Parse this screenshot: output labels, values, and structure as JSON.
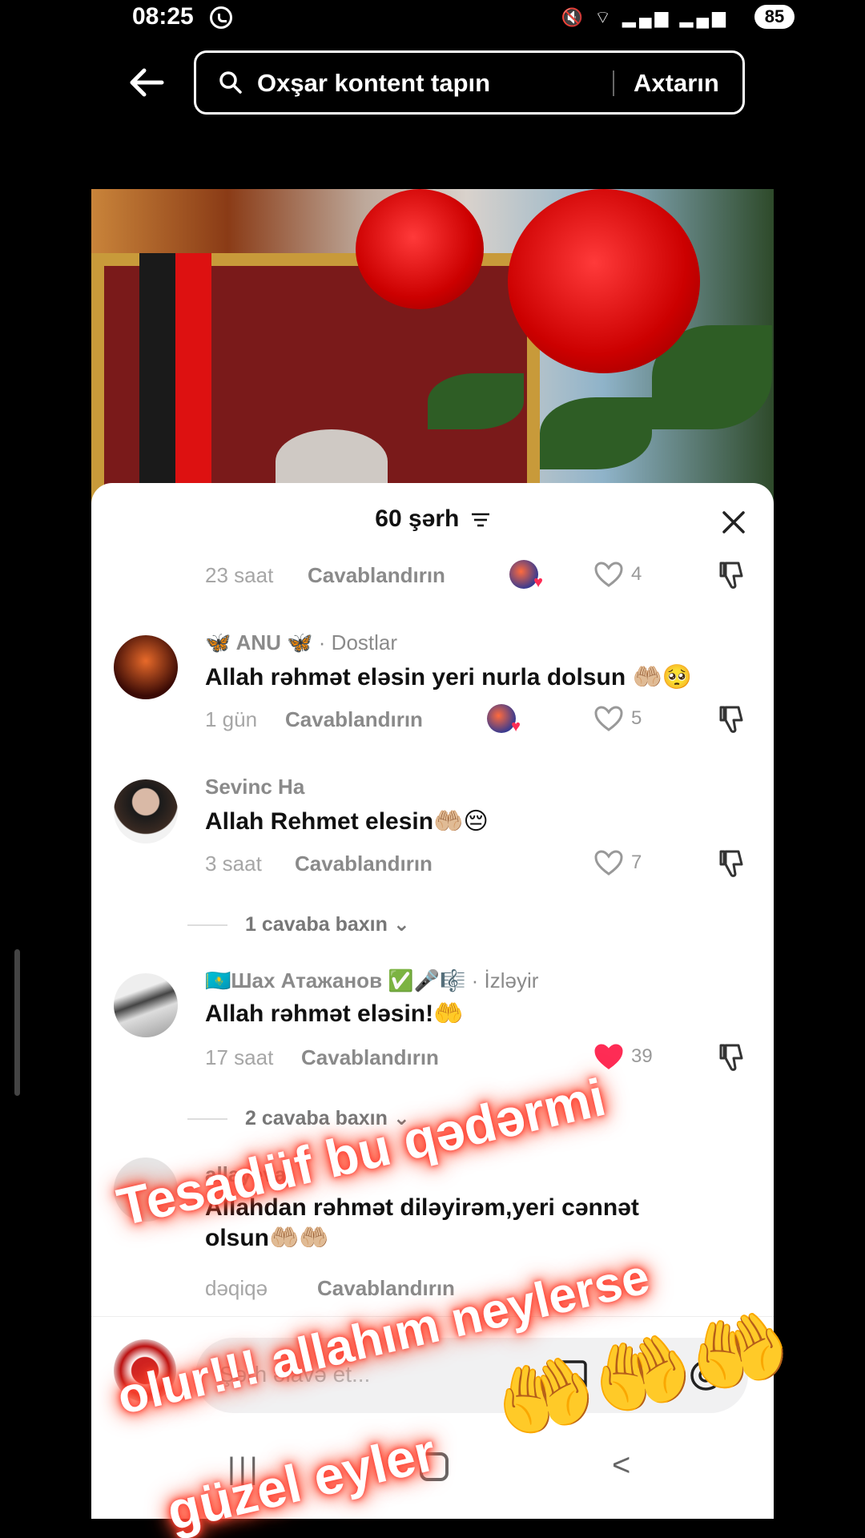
{
  "status_bar": {
    "time": "08:25",
    "battery": "85"
  },
  "search": {
    "placeholder": "Oxşar kontent tapın",
    "button": "Axtarın"
  },
  "comments_sheet": {
    "title": "60 şərh",
    "input_placeholder": "Şərh əlavə et...",
    "top_meta": {
      "time": "23 saat",
      "reply": "Cavablandırın",
      "likes": "4"
    },
    "comments": [
      {
        "user": "🦋 ANU 🦋",
        "tag": " · Dostlar",
        "text": "Allah rəhmət eləsin yeri nurla dolsun 🤲🏼🥺",
        "time": "1 gün",
        "reply": "Cavablandırın",
        "likes": "5"
      },
      {
        "user": "Sevinc Ha",
        "tag": "",
        "text": "Allah Rehmet elesin🤲🏼😔",
        "time": "3 saat",
        "reply": "Cavablandırın",
        "likes": "7",
        "view_replies": "1 cavaba baxın"
      },
      {
        "user": "🇰🇿Шах Атажанов ✅🎤🎼",
        "tag": " · İzləyir",
        "text": "Allah rəhmət eləsin!🤲",
        "time": "17 saat",
        "reply": "Cavablandırın",
        "likes": "39",
        "view_replies": "2 cavaba baxın"
      },
      {
        "user": "allayeva",
        "tag": "",
        "text": "Allahdan rəhmət diləyirəm,yeri cənnət olsun🤲🏼🤲🏼",
        "time": "dəqiqə",
        "reply": "Cavablandırın",
        "likes": ""
      }
    ]
  },
  "overlay_text": {
    "line1": "Tesadüf bu qədərmi",
    "line2": "olur!!! allahım neylerse",
    "line3": "güzel eyler",
    "hands": "🤲🤲🤲"
  },
  "colors": {
    "accent_like": "#fe2c55",
    "glow": "#ff3b2f"
  }
}
